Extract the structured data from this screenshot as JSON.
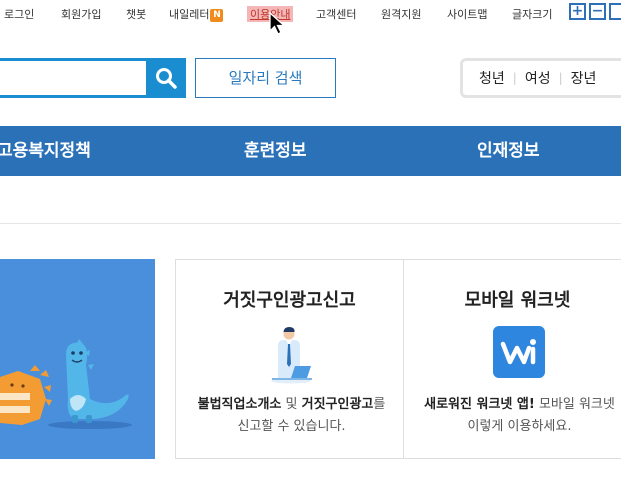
{
  "topbar": {
    "login": "로그인",
    "signup": "회원가입",
    "chatbot": "챗봇",
    "my_letter": "내일레터",
    "my_letter_badge": "N",
    "usage_guide": "이용안내",
    "customer_center": "고객센터",
    "remote_support": "원격지원",
    "sitemap": "사이트맵",
    "font_size": "글자크기",
    "font_plus": "+",
    "font_minus": "−"
  },
  "search": {
    "input_value": "",
    "job_search_label": "일자리 검색",
    "targets": [
      "청년",
      "여성",
      "장년"
    ]
  },
  "nav": {
    "items": [
      "고용복지정책",
      "훈련정보",
      "인재정보"
    ]
  },
  "cards": [
    {
      "title": "거짓구인광고신고",
      "desc_bold1": "불법직업소개소",
      "desc_mid": " 및 ",
      "desc_bold2": "거짓구인광고",
      "desc_rest": "를 신고할 수 있습니다.",
      "icon": "office-worker-laptop-icon"
    },
    {
      "title": "모바일 워크넷",
      "desc_bold1": "새로워진 워크넷 앱!",
      "desc_rest": " 모바일 워크넷 이렇게 이용하세요.",
      "icon": "worknet-app-icon"
    }
  ],
  "colors": {
    "primary": "#2a71b8",
    "search_blue": "#1a8cd0",
    "badge_orange": "#f08c1b",
    "banner_blue": "#4a8fdb",
    "highlight": "#f4b6b6"
  }
}
